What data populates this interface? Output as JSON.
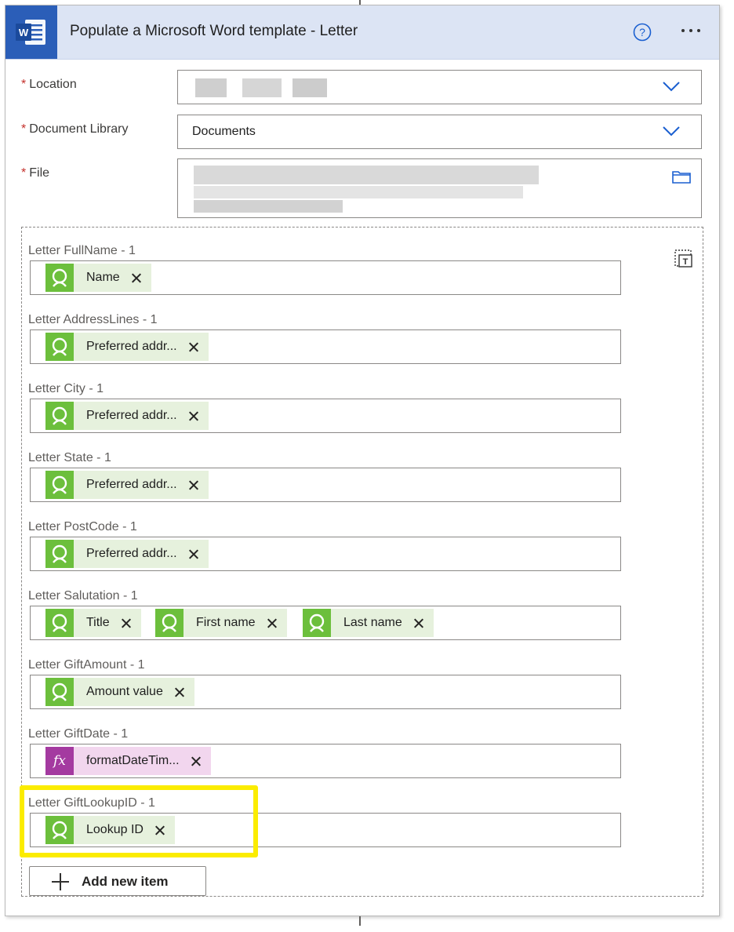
{
  "header": {
    "title": "Populate a Microsoft Word template - Letter",
    "app_icon": "word-icon",
    "help_icon": "question-circle-icon",
    "more_icon": "ellipsis-icon"
  },
  "fields": {
    "location": {
      "label": "Location",
      "required": "*",
      "value": ""
    },
    "document_library": {
      "label": "Document Library",
      "required": "*",
      "value": "Documents"
    },
    "file": {
      "label": "File",
      "required": "*",
      "value": ""
    }
  },
  "items": [
    {
      "label": "Letter FullName - 1",
      "tokens": [
        {
          "text": "Name",
          "kind": "dynamic"
        }
      ]
    },
    {
      "label": "Letter AddressLines - 1",
      "tokens": [
        {
          "text": "Preferred addr...",
          "kind": "dynamic"
        }
      ]
    },
    {
      "label": "Letter City - 1",
      "tokens": [
        {
          "text": "Preferred addr...",
          "kind": "dynamic"
        }
      ]
    },
    {
      "label": "Letter State - 1",
      "tokens": [
        {
          "text": "Preferred addr...",
          "kind": "dynamic"
        }
      ]
    },
    {
      "label": "Letter PostCode - 1",
      "tokens": [
        {
          "text": "Preferred addr...",
          "kind": "dynamic"
        }
      ]
    },
    {
      "label": "Letter Salutation - 1",
      "tokens": [
        {
          "text": "Title",
          "kind": "dynamic"
        },
        {
          "text": "First name",
          "kind": "dynamic"
        },
        {
          "text": "Last name",
          "kind": "dynamic"
        }
      ]
    },
    {
      "label": "Letter GiftAmount - 1",
      "tokens": [
        {
          "text": "Amount value",
          "kind": "dynamic"
        }
      ]
    },
    {
      "label": "Letter GiftDate - 1",
      "tokens": [
        {
          "text": "formatDateTim...",
          "kind": "expression"
        }
      ]
    },
    {
      "label": "Letter GiftLookupID - 1",
      "tokens": [
        {
          "text": "Lookup ID",
          "kind": "dynamic"
        }
      ]
    }
  ],
  "add_item": {
    "label": "Add new item"
  },
  "fx_glyph": "fx",
  "colors": {
    "header_bg": "#dce4f4",
    "word_blue": "#2b5eb8",
    "dynamic_token_bg": "#e6f1dd",
    "dynamic_icon_bg": "#6cbf3c",
    "expression_token_bg": "#f2d6ee",
    "expression_icon_bg": "#a43aa0",
    "highlight": "#fbec00",
    "required": "#c4302b"
  }
}
